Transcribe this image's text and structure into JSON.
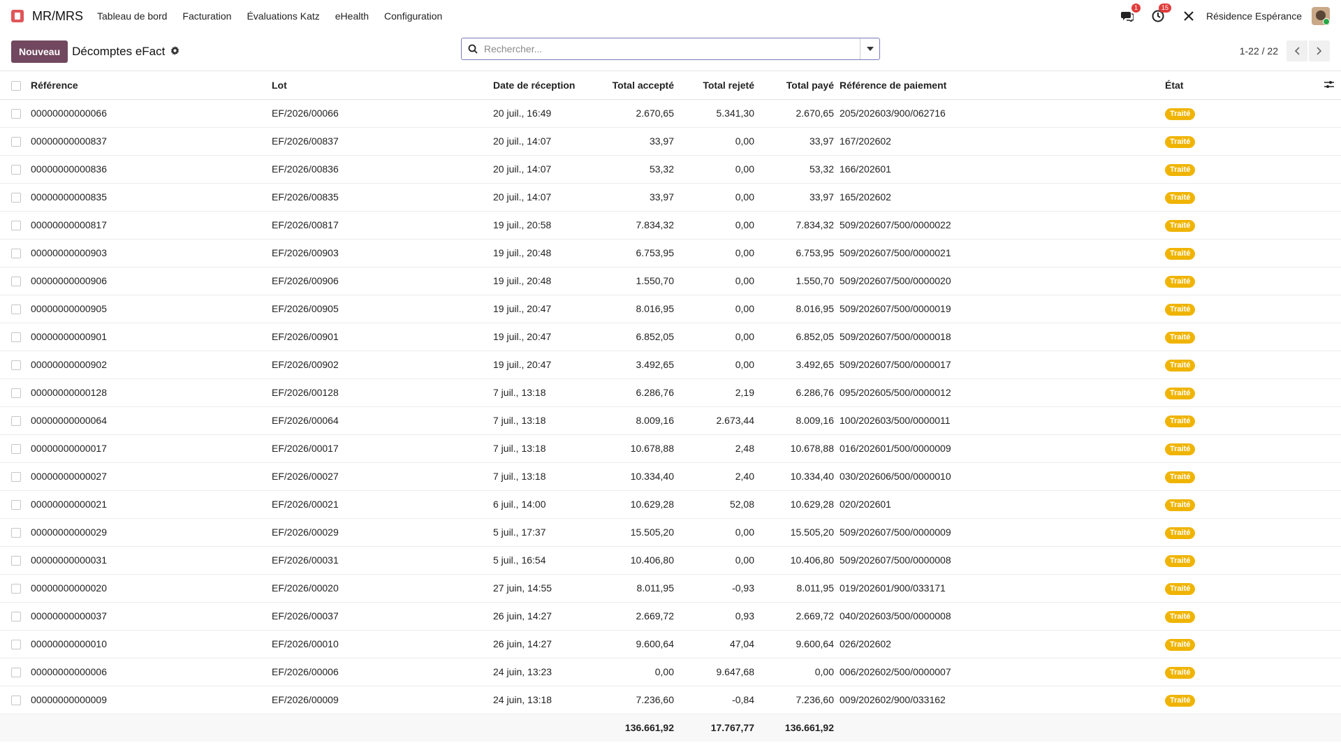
{
  "navbar": {
    "app_name": "MR/MRS",
    "menu": [
      "Tableau de bord",
      "Facturation",
      "Évaluations Katz",
      "eHealth",
      "Configuration"
    ],
    "messages_badge": "1",
    "activities_badge": "15",
    "company": "Résidence Espérance",
    "colors": {
      "badge": "#e03c3c"
    }
  },
  "control": {
    "new_label": "Nouveau",
    "title": "Décomptes eFact",
    "search_placeholder": "Rechercher...",
    "pager": "1-22 / 22"
  },
  "table": {
    "headers": {
      "reference": "Référence",
      "lot": "Lot",
      "date": "Date de réception",
      "accepted": "Total accepté",
      "rejected": "Total rejeté",
      "paid": "Total payé",
      "payment_ref": "Référence de paiement",
      "state": "État"
    },
    "status_color": "#f0b400",
    "rows": [
      [
        "00000000000066",
        "EF/2026/00066",
        "20 juil., 16:49",
        "2.670,65",
        "5.341,30",
        "2.670,65",
        "205/202603/900/062716",
        "Traité"
      ],
      [
        "00000000000837",
        "EF/2026/00837",
        "20 juil., 14:07",
        "33,97",
        "0,00",
        "33,97",
        "167/202602",
        "Traité"
      ],
      [
        "00000000000836",
        "EF/2026/00836",
        "20 juil., 14:07",
        "53,32",
        "0,00",
        "53,32",
        "166/202601",
        "Traité"
      ],
      [
        "00000000000835",
        "EF/2026/00835",
        "20 juil., 14:07",
        "33,97",
        "0,00",
        "33,97",
        "165/202602",
        "Traité"
      ],
      [
        "00000000000817",
        "EF/2026/00817",
        "19 juil., 20:58",
        "7.834,32",
        "0,00",
        "7.834,32",
        "509/202607/500/0000022",
        "Traité"
      ],
      [
        "00000000000903",
        "EF/2026/00903",
        "19 juil., 20:48",
        "6.753,95",
        "0,00",
        "6.753,95",
        "509/202607/500/0000021",
        "Traité"
      ],
      [
        "00000000000906",
        "EF/2026/00906",
        "19 juil., 20:48",
        "1.550,70",
        "0,00",
        "1.550,70",
        "509/202607/500/0000020",
        "Traité"
      ],
      [
        "00000000000905",
        "EF/2026/00905",
        "19 juil., 20:47",
        "8.016,95",
        "0,00",
        "8.016,95",
        "509/202607/500/0000019",
        "Traité"
      ],
      [
        "00000000000901",
        "EF/2026/00901",
        "19 juil., 20:47",
        "6.852,05",
        "0,00",
        "6.852,05",
        "509/202607/500/0000018",
        "Traité"
      ],
      [
        "00000000000902",
        "EF/2026/00902",
        "19 juil., 20:47",
        "3.492,65",
        "0,00",
        "3.492,65",
        "509/202607/500/0000017",
        "Traité"
      ],
      [
        "00000000000128",
        "EF/2026/00128",
        "7 juil., 13:18",
        "6.286,76",
        "2,19",
        "6.286,76",
        "095/202605/500/0000012",
        "Traité"
      ],
      [
        "00000000000064",
        "EF/2026/00064",
        "7 juil., 13:18",
        "8.009,16",
        "2.673,44",
        "8.009,16",
        "100/202603/500/0000011",
        "Traité"
      ],
      [
        "00000000000017",
        "EF/2026/00017",
        "7 juil., 13:18",
        "10.678,88",
        "2,48",
        "10.678,88",
        "016/202601/500/0000009",
        "Traité"
      ],
      [
        "00000000000027",
        "EF/2026/00027",
        "7 juil., 13:18",
        "10.334,40",
        "2,40",
        "10.334,40",
        "030/202606/500/0000010",
        "Traité"
      ],
      [
        "00000000000021",
        "EF/2026/00021",
        "6 juil., 14:00",
        "10.629,28",
        "52,08",
        "10.629,28",
        "020/202601",
        "Traité"
      ],
      [
        "00000000000029",
        "EF/2026/00029",
        "5 juil., 17:37",
        "15.505,20",
        "0,00",
        "15.505,20",
        "509/202607/500/0000009",
        "Traité"
      ],
      [
        "00000000000031",
        "EF/2026/00031",
        "5 juil., 16:54",
        "10.406,80",
        "0,00",
        "10.406,80",
        "509/202607/500/0000008",
        "Traité"
      ],
      [
        "00000000000020",
        "EF/2026/00020",
        "27 juin, 14:55",
        "8.011,95",
        "-0,93",
        "8.011,95",
        "019/202601/900/033171",
        "Traité"
      ],
      [
        "00000000000037",
        "EF/2026/00037",
        "26 juin, 14:27",
        "2.669,72",
        "0,93",
        "2.669,72",
        "040/202603/500/0000008",
        "Traité"
      ],
      [
        "00000000000010",
        "EF/2026/00010",
        "26 juin, 14:27",
        "9.600,64",
        "47,04",
        "9.600,64",
        "026/202602",
        "Traité"
      ],
      [
        "00000000000006",
        "EF/2026/00006",
        "24 juin, 13:23",
        "0,00",
        "9.647,68",
        "0,00",
        "006/202602/500/0000007",
        "Traité"
      ],
      [
        "00000000000009",
        "EF/2026/00009",
        "24 juin, 13:18",
        "7.236,60",
        "-0,84",
        "7.236,60",
        "009/202602/900/033162",
        "Traité"
      ]
    ],
    "totals": {
      "accepted": "136.661,92",
      "rejected": "17.767,77",
      "paid": "136.661,92"
    }
  }
}
